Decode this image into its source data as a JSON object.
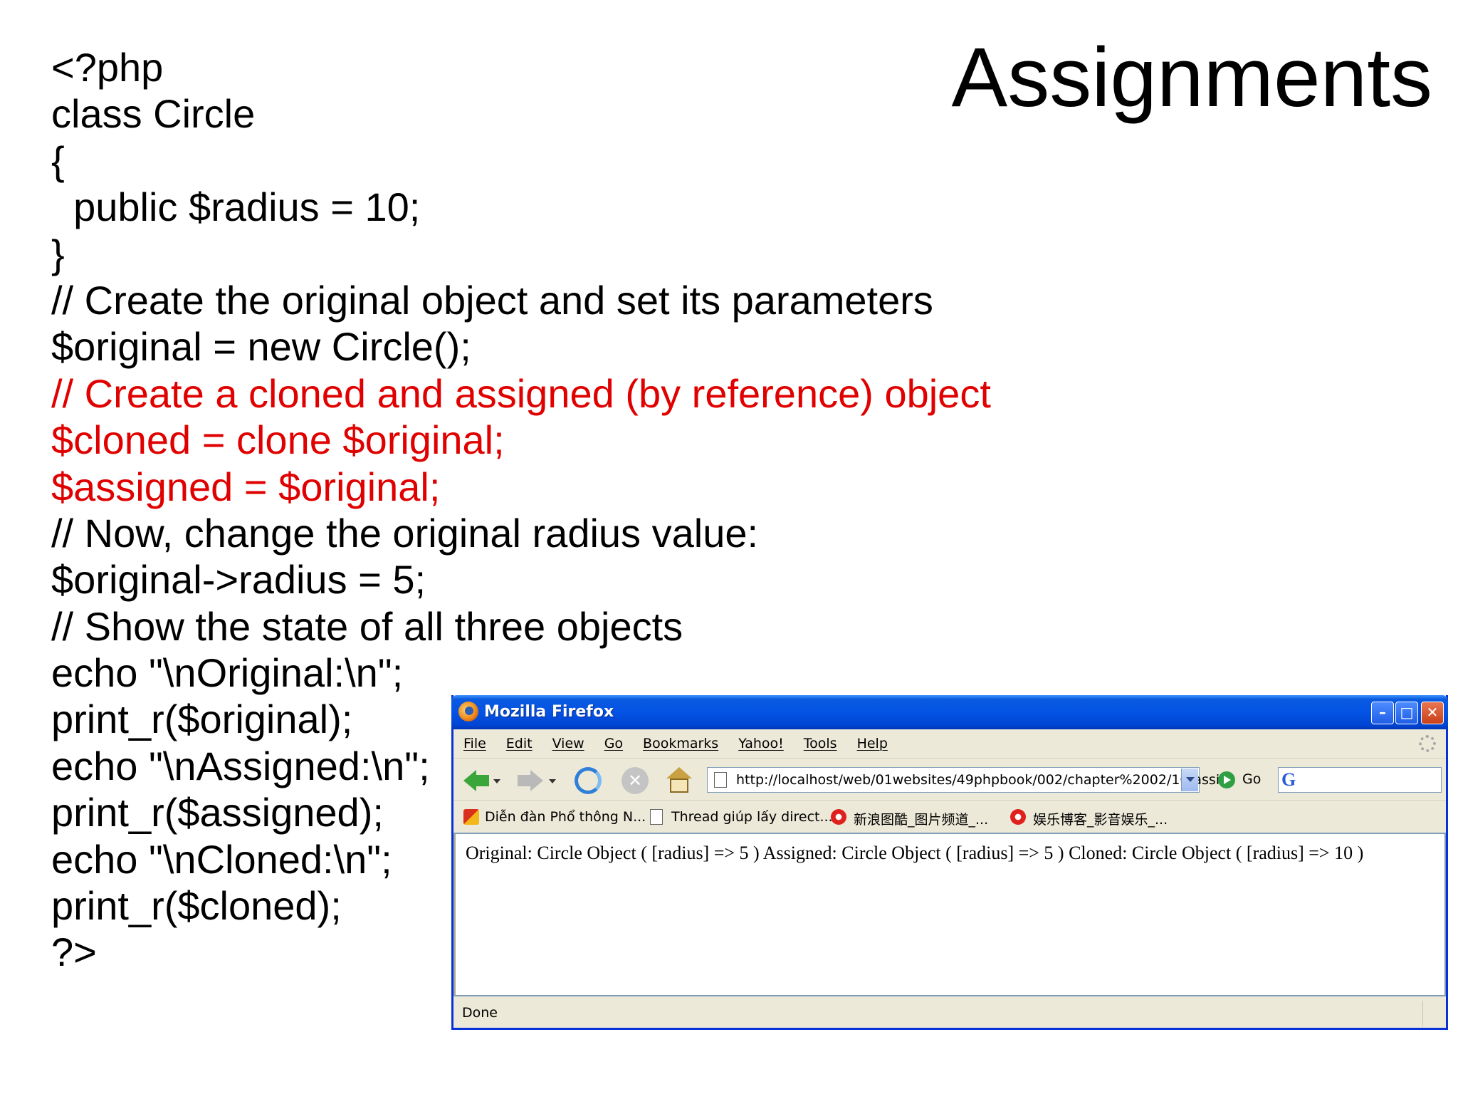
{
  "slide": {
    "title": "Assignments",
    "code_lines": [
      {
        "text": "<?php",
        "highlight": false
      },
      {
        "text": "class Circle",
        "highlight": false
      },
      {
        "text": "{",
        "highlight": false
      },
      {
        "text": "  public $radius = 10;",
        "highlight": false
      },
      {
        "text": "}",
        "highlight": false
      },
      {
        "text": "// Create the original object and set its parameters",
        "highlight": false
      },
      {
        "text": "$original = new Circle();",
        "highlight": false
      },
      {
        "text": "// Create a cloned and assigned (by reference) object",
        "highlight": true
      },
      {
        "text": "$cloned = clone $original;",
        "highlight": true
      },
      {
        "text": "$assigned = $original;",
        "highlight": true
      },
      {
        "text": "// Now, change the original radius value:",
        "highlight": false
      },
      {
        "text": "$original->radius = 5;",
        "highlight": false
      },
      {
        "text": "// Show the state of all three objects",
        "highlight": false
      },
      {
        "text": "echo \"\\nOriginal:\\n\";",
        "highlight": false
      },
      {
        "text": "print_r($original);",
        "highlight": false
      },
      {
        "text": "echo \"\\nAssigned:\\n\";",
        "highlight": false
      },
      {
        "text": "print_r($assigned);",
        "highlight": false
      },
      {
        "text": "echo \"\\nCloned:\\n\";",
        "highlight": false
      },
      {
        "text": "print_r($cloned);",
        "highlight": false
      },
      {
        "text": "?>",
        "highlight": false
      }
    ],
    "highlight_color": "#e00000"
  },
  "browser": {
    "title": "Mozilla Firefox",
    "window_buttons": {
      "minimize": "–",
      "maximize": "□",
      "close": "✕"
    },
    "menu": [
      "File",
      "Edit",
      "View",
      "Go",
      "Bookmarks",
      "Yahoo!",
      "Tools",
      "Help"
    ],
    "url": "http://localhost/web/01websites/49phpbook/002/chapter%2002/10-assi",
    "go_label": "Go",
    "search_icon_letter": "G",
    "stop_glyph": "✕",
    "bookmarks": [
      "Diễn đàn Phổ thông N...",
      "Thread giúp lấy direct...",
      "新浪图酷_图片频道_...",
      "娱乐博客_影音娱乐_..."
    ],
    "page_content": "Original: Circle Object ( [radius] => 5 ) Assigned: Circle Object ( [radius] => 5 ) Cloned: Circle Object ( [radius] => 10 )",
    "status": "Done",
    "colors": {
      "titlebar": "#0453e5",
      "chrome": "#ece9d8",
      "border": "#0831d9"
    }
  }
}
